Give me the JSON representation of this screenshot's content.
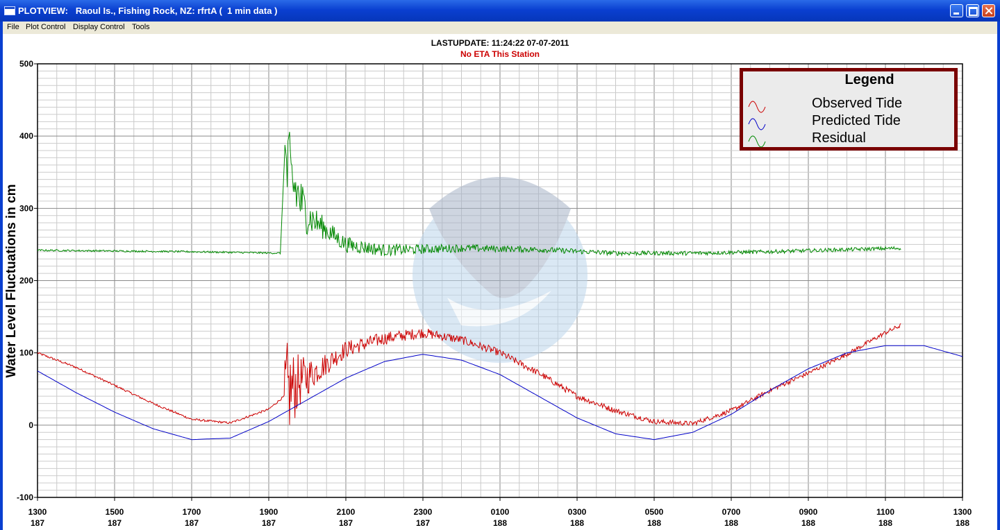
{
  "window": {
    "title": "PLOTVIEW:   Raoul Is., Fishing Rock, NZ: rfrtA (  1 min data )"
  },
  "menu": {
    "items": [
      "File",
      "Plot Control",
      "Display Control",
      "Tools"
    ]
  },
  "header": {
    "lastupdate": "LASTUPDATE: 11:24:22  07-07-2011",
    "eta": "No ETA This Station"
  },
  "colors": {
    "observed": "#cc0000",
    "predicted": "#0000c8",
    "residual": "#008800",
    "legend_border": "#7a0000",
    "eta_text": "#cc0000"
  },
  "chart_data": {
    "type": "line",
    "title": "",
    "ylabel": "Water Level Fluctuations in cm",
    "xlabel": "",
    "ylim": [
      -100,
      500
    ],
    "yticks": [
      -100,
      0,
      100,
      200,
      300,
      400,
      500
    ],
    "xlim_hours": [
      13,
      37
    ],
    "xticks": [
      {
        "time": "1300",
        "day": "187"
      },
      {
        "time": "1500",
        "day": "187"
      },
      {
        "time": "1700",
        "day": "187"
      },
      {
        "time": "1900",
        "day": "187"
      },
      {
        "time": "2100",
        "day": "187"
      },
      {
        "time": "2300",
        "day": "187"
      },
      {
        "time": "0100",
        "day": "188"
      },
      {
        "time": "0300",
        "day": "188"
      },
      {
        "time": "0500",
        "day": "188"
      },
      {
        "time": "0700",
        "day": "188"
      },
      {
        "time": "0900",
        "day": "188"
      },
      {
        "time": "1100",
        "day": "188"
      },
      {
        "time": "1300",
        "day": "188"
      }
    ],
    "grid": true,
    "legend": {
      "title": "Legend",
      "position": "top-right",
      "entries": [
        "Observed Tide",
        "Predicted Tide",
        "Residual"
      ]
    },
    "series": [
      {
        "name": "Observed Tide",
        "x": [
          13,
          14,
          15,
          16,
          17,
          18,
          19,
          19.4,
          19.8,
          20.5,
          21,
          22,
          23,
          24,
          25,
          26,
          27,
          28,
          29,
          30,
          31,
          32,
          33,
          34,
          35,
          35.4
        ],
        "values": [
          100,
          80,
          55,
          30,
          8,
          3,
          22,
          40,
          60,
          85,
          105,
          120,
          128,
          118,
          100,
          72,
          40,
          20,
          5,
          2,
          20,
          48,
          72,
          98,
          128,
          138
        ]
      },
      {
        "name": "Predicted Tide",
        "x": [
          13,
          14,
          15,
          16,
          17,
          18,
          19,
          20,
          21,
          22,
          23,
          24,
          25,
          26,
          27,
          28,
          29,
          30,
          31,
          32,
          33,
          34,
          35,
          36,
          37
        ],
        "values": [
          75,
          45,
          18,
          -5,
          -20,
          -18,
          5,
          35,
          65,
          88,
          98,
          90,
          70,
          40,
          10,
          -12,
          -20,
          -10,
          15,
          48,
          78,
          100,
          110,
          110,
          95
        ]
      },
      {
        "name": "Residual",
        "x": [
          13,
          17,
          19.3,
          19.4,
          20,
          21,
          22,
          24,
          26,
          28,
          30,
          32,
          35.4
        ],
        "values": [
          242,
          240,
          238,
          360,
          290,
          250,
          242,
          245,
          243,
          238,
          238,
          240,
          245
        ]
      }
    ]
  }
}
